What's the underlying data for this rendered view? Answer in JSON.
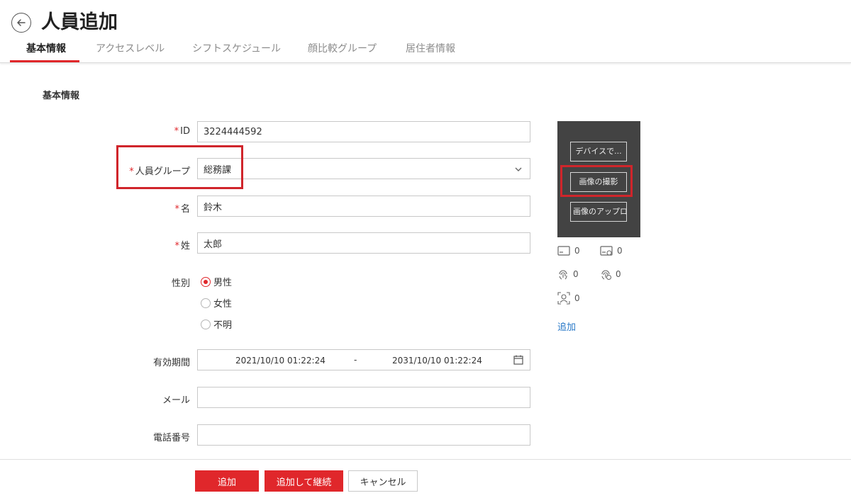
{
  "header": {
    "title": "人員追加"
  },
  "tabs": [
    {
      "label": "基本情報",
      "active": true
    },
    {
      "label": "アクセスレベル",
      "active": false
    },
    {
      "label": "シフトスケジュール",
      "active": false
    },
    {
      "label": "顔比較グループ",
      "active": false
    },
    {
      "label": "居住者情報",
      "active": false
    }
  ],
  "section": {
    "title": "基本情報"
  },
  "form": {
    "required_mark": "*",
    "id": {
      "label": "ID",
      "value": "3224444592"
    },
    "group": {
      "label": "人員グループ",
      "value": "総務課"
    },
    "first_name": {
      "label": "名",
      "value": "鈴木"
    },
    "last_name": {
      "label": "姓",
      "value": "太郎"
    },
    "gender": {
      "label": "性別",
      "options": [
        "男性",
        "女性",
        "不明"
      ],
      "selected": "男性"
    },
    "validity": {
      "label": "有効期間",
      "start": "2021/10/10 01:22:24",
      "separator": "-",
      "end": "2031/10/10 01:22:24"
    },
    "email": {
      "label": "メール",
      "value": ""
    },
    "phone": {
      "label": "電話番号",
      "value": ""
    }
  },
  "photo": {
    "device_button": "デバイスで...",
    "capture_button": "画像の撮影",
    "upload_button": "画像のアップロード"
  },
  "credentials": {
    "card": "0",
    "card_alt": "0",
    "fingerprint": "0",
    "fingerprint_alt": "0",
    "face": "0",
    "add_link": "追加"
  },
  "footer": {
    "add_button": "追加",
    "add_continue_button": "追加して継続",
    "cancel_button": "キャンセル"
  },
  "colors": {
    "accent": "#e0272b",
    "link": "#2979c8",
    "photo_bg": "#434343",
    "highlight": "#d0252b"
  }
}
